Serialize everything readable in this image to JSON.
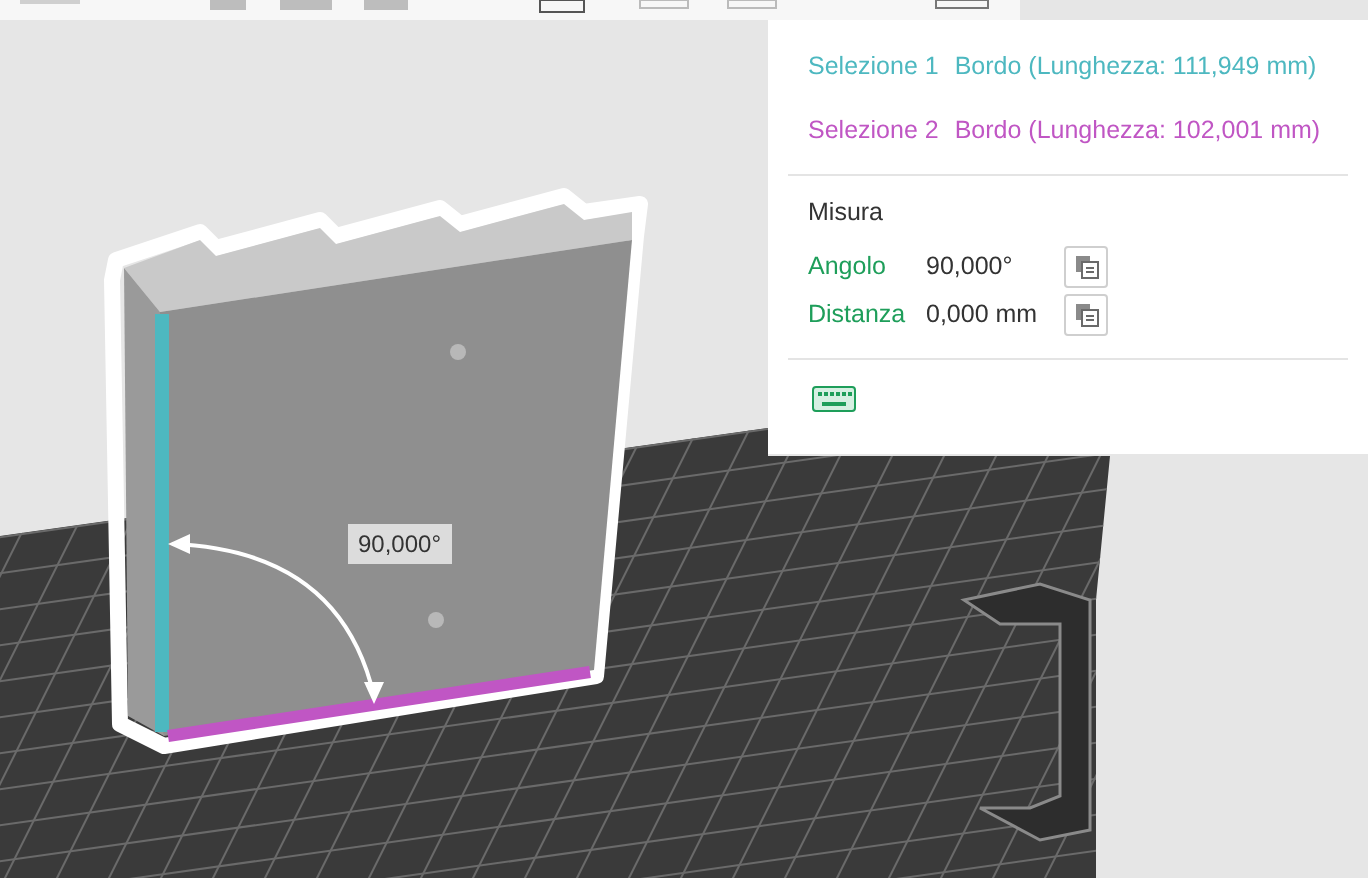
{
  "viewport": {
    "angle_label": "90,000°"
  },
  "panel": {
    "selections": [
      {
        "label": "Selezione 1",
        "value": "Bordo (Lunghezza: 111,949 mm)",
        "color": "#4db8c0"
      },
      {
        "label": "Selezione 2",
        "value": "Bordo (Lunghezza: 102,001 mm)",
        "color": "#c056c4"
      }
    ],
    "measure": {
      "title": "Misura",
      "rows": [
        {
          "label": "Angolo",
          "value": "90,000°"
        },
        {
          "label": "Distanza",
          "value": "0,000 mm"
        }
      ]
    }
  }
}
